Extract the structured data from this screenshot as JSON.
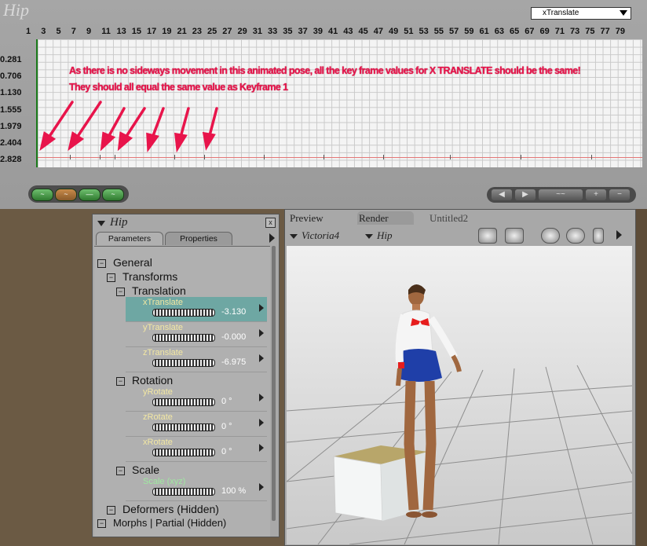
{
  "graph": {
    "title": "Hip",
    "parameter_selected": "xTranslate",
    "frame_numbers": [
      "1",
      "3",
      "5",
      "7",
      "9",
      "11",
      "13",
      "15",
      "17",
      "19",
      "21",
      "23",
      "25",
      "27",
      "29",
      "31",
      "33",
      "35",
      "37",
      "39",
      "41",
      "43",
      "45",
      "47",
      "49",
      "51",
      "53",
      "55",
      "57",
      "59",
      "61",
      "63",
      "65",
      "67",
      "69",
      "71",
      "73",
      "75",
      "77",
      "79"
    ],
    "value_labels": [
      "0.281",
      "0.706",
      "1.130",
      "1.555",
      "1.979",
      "2.404",
      "2.828"
    ],
    "annotation": [
      "As there is no sideways movement in this animated pose, all the key frame values for X TRANSLATE  should be the same!",
      "They should all equal the same value as Keyframe 1"
    ],
    "curve_buttons": [
      "~",
      "~",
      "—",
      "~"
    ],
    "playback_buttons": [
      "◀",
      "▶",
      "~~",
      "+",
      "−"
    ],
    "colors": {
      "annotation": "#e8144b",
      "curve": "#e37777",
      "grid": "#c9c9c9"
    }
  },
  "params": {
    "title": "Hip",
    "close_label": "x",
    "tabs": [
      "Parameters",
      "Properties"
    ],
    "sections": {
      "general": "General",
      "transforms": "Transforms",
      "translation": "Translation",
      "rotation": "Rotation",
      "scale": "Scale",
      "deformers": "Deformers (Hidden)",
      "morphs": "Morphs | Partial (Hidden)"
    },
    "items": {
      "xTranslate": {
        "name": "xTranslate",
        "value": "-3.130"
      },
      "yTranslate": {
        "name": "yTranslate",
        "value": "-0.000"
      },
      "zTranslate": {
        "name": "zTranslate",
        "value": "-6.975"
      },
      "yRotate": {
        "name": "yRotate",
        "value": "0 °"
      },
      "zRotate": {
        "name": "zRotate",
        "value": "0 °"
      },
      "xRotate": {
        "name": "xRotate",
        "value": "0 °"
      },
      "scale": {
        "name": "Scale (xyz)",
        "value": "100 %"
      }
    }
  },
  "preview": {
    "tabs": [
      "Preview",
      "Render",
      "Untitled2"
    ],
    "figure_dropdown": "Victoria4",
    "actor_dropdown": "Hip"
  }
}
